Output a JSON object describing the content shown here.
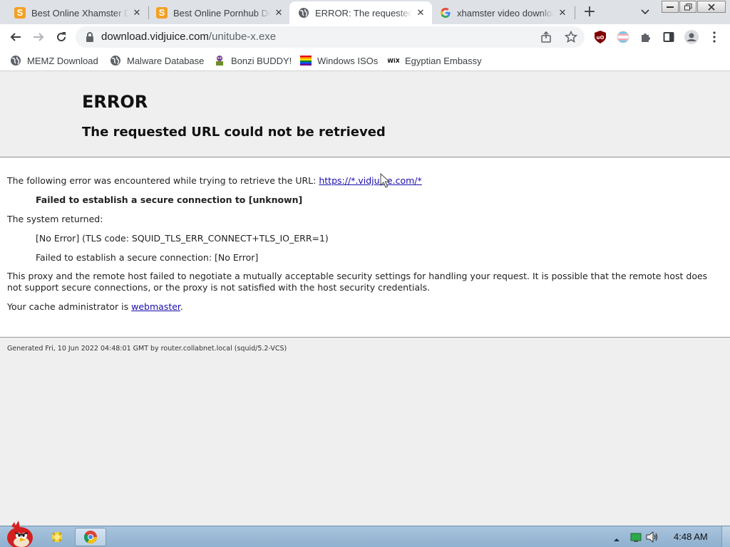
{
  "tabs": [
    {
      "title": "Best Online Xhamster Do",
      "icon": "s-icon",
      "active": false
    },
    {
      "title": "Best Online Pornhub Dow",
      "icon": "s-icon",
      "active": false
    },
    {
      "title": "ERROR: The requested URL",
      "icon": "globe-icon",
      "active": true
    },
    {
      "title": "xhamster video downloade",
      "icon": "google-icon",
      "active": false
    }
  ],
  "omnibox": {
    "domain": "download.vidjuice.com",
    "path": "/unitube-x.exe"
  },
  "bookmarks": [
    {
      "label": "MEMZ Download",
      "icon": "globe-icon"
    },
    {
      "label": "Malware Database",
      "icon": "globe-icon"
    },
    {
      "label": "Bonzi BUDDY!",
      "icon": "bonzi-icon"
    },
    {
      "label": "Windows ISOs",
      "icon": "rainbow-flag-icon"
    },
    {
      "label": "Egyptian Embassy",
      "icon": "wix-icon"
    }
  ],
  "error_page": {
    "title": "ERROR",
    "subtitle": "The requested URL could not be retrieved",
    "intro": "The following error was encountered while trying to retrieve the URL: ",
    "url_link": "https://*.vidjuice.com/*",
    "failure": "Failed to establish a secure connection to [unknown]",
    "system_returned": "The system returned:",
    "tls_code": "[No Error] (TLS code: SQUID_TLS_ERR_CONNECT+TLS_IO_ERR=1)",
    "secure_failed": "Failed to establish a secure connection: [No Error]",
    "explanation": "This proxy and the remote host failed to negotiate a mutually acceptable security settings for handling your request. It is possible that the remote host does not support secure connections, or the proxy is not satisfied with the host security credentials.",
    "cache_admin_prefix": "Your cache administrator is ",
    "webmaster": "webmaster",
    "cache_admin_suffix": ".",
    "footer": "Generated Fri, 10 Jun 2022 04:48:01 GMT by router.collabnet.local (squid/5.2-VCS)"
  },
  "taskbar": {
    "clock": "4:48 AM"
  },
  "colors": {
    "link": "#1a0dab",
    "tab_strip": "#dee1e6",
    "s_icon": "#f4a024"
  }
}
